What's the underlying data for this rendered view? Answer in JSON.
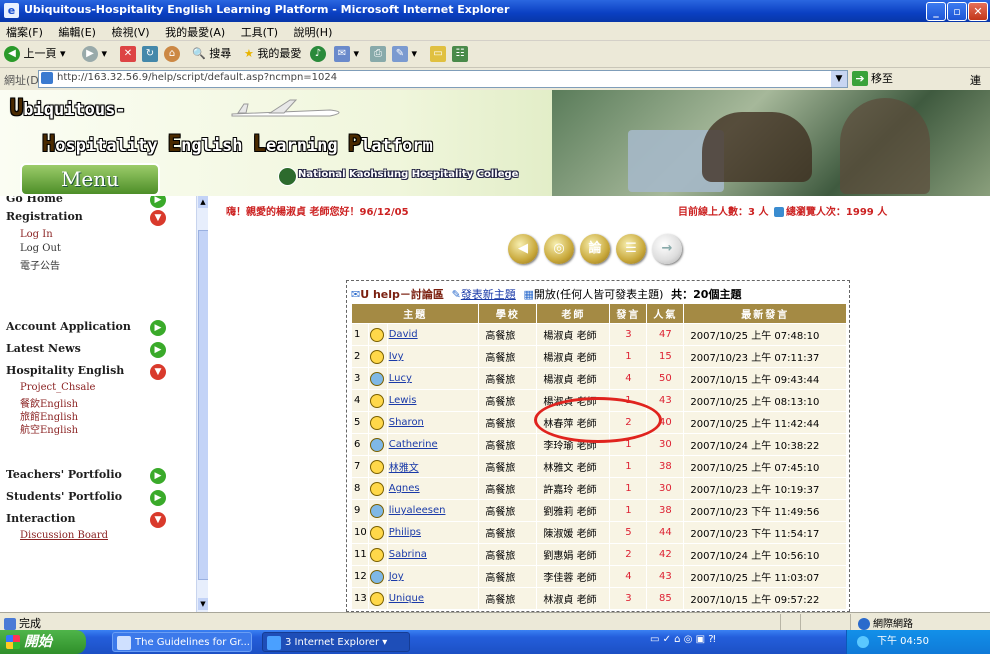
{
  "window": {
    "title": "Ubiquitous-Hospitality English Learning Platform - Microsoft Internet Explorer",
    "min": "_",
    "max": "▫",
    "close": "✕"
  },
  "menubar": [
    "檔案(F)",
    "編輯(E)",
    "檢視(V)",
    "我的最愛(A)",
    "工具(T)",
    "說明(H)"
  ],
  "toolbar": {
    "back": "上一頁",
    "search": "搜尋",
    "favorites": "我的最愛"
  },
  "address": {
    "label": "網址(D)",
    "url": "http://163.32.56.9/help/script/default.asp?ncmpn=1024",
    "go": "移至",
    "links": "連"
  },
  "banner": {
    "line1_first": "U",
    "line1_rest": "biquitous-",
    "line2_h": "H",
    "line2_h_rest": "ospitality ",
    "line2_e": "E",
    "line2_e_rest": "nglish ",
    "line2_l": "L",
    "line2_l_rest": "earning ",
    "line2_p": "P",
    "line2_p_rest": "latform",
    "college": "National Kaohsiung Hospitality College",
    "menu_tab": "Menu"
  },
  "sidebar": {
    "go_home": "Go Home",
    "registration": "Registration",
    "login": "Log In",
    "logout": "Log Out",
    "epaper": "電子公告",
    "account_application": "Account Application",
    "latest_news": "Latest News",
    "hospitality_english": "Hospitality English",
    "sub_links": [
      "Project_Chsale",
      "餐飲English",
      "旅館English",
      "航空English"
    ],
    "teachers_portfolio": "Teachers' Portfolio",
    "students_portfolio": "Students' Portfolio",
    "interaction": "Interaction",
    "discussion_board": "Discussion Board"
  },
  "main": {
    "greeting": "嗨！親愛的楊淑貞 老師您好！96/12/05",
    "online_prefix": "目前線上人數：3 人",
    "online_visits": "總瀏覽人次：1999 人",
    "round_buttons": [
      "◀",
      "◎",
      "論",
      "☰",
      "→"
    ],
    "board": {
      "title": "U help－討論區",
      "post_link": "發表新主題",
      "scope": "開放(任何人皆可發表主題)",
      "total": "共：20個主題",
      "columns": [
        "主題",
        "學校",
        "老師",
        "發言",
        "人氣",
        "最新發言"
      ],
      "rows": [
        {
          "no": "1",
          "subject": "David",
          "school": "高餐旅",
          "teacher": "楊淑貞 老師",
          "posts": "3",
          "views": "47",
          "latest": "2007/10/25 上午 07:48:10"
        },
        {
          "no": "2",
          "subject": "Ivy",
          "school": "高餐旅",
          "teacher": "楊淑貞 老師",
          "posts": "1",
          "views": "15",
          "latest": "2007/10/23 上午 07:11:37"
        },
        {
          "no": "3",
          "subject": "Lucy",
          "school": "高餐旅",
          "teacher": "楊淑貞 老師",
          "posts": "4",
          "views": "50",
          "latest": "2007/10/15 上午 09:43:44"
        },
        {
          "no": "4",
          "subject": "Lewis",
          "school": "高餐旅",
          "teacher": "楊淑貞 老師",
          "posts": "1",
          "views": "43",
          "latest": "2007/10/25 上午 08:13:10"
        },
        {
          "no": "5",
          "subject": "Sharon",
          "school": "高餐旅",
          "teacher": "林春萍 老師",
          "posts": "2",
          "views": "40",
          "latest": "2007/10/25 上午 11:42:44"
        },
        {
          "no": "6",
          "subject": "Catherine",
          "school": "高餐旅",
          "teacher": "李玲瑜 老師",
          "posts": "1",
          "views": "30",
          "latest": "2007/10/24 上午 10:38:22"
        },
        {
          "no": "7",
          "subject": "林雅文",
          "school": "高餐旅",
          "teacher": "林雅文 老師",
          "posts": "1",
          "views": "38",
          "latest": "2007/10/25 上午 07:45:10"
        },
        {
          "no": "8",
          "subject": "Agnes",
          "school": "高餐旅",
          "teacher": "許嘉玲 老師",
          "posts": "1",
          "views": "30",
          "latest": "2007/10/23 上午 10:19:37"
        },
        {
          "no": "9",
          "subject": "liuyaleesen",
          "school": "高餐旅",
          "teacher": "劉雅莉 老師",
          "posts": "1",
          "views": "38",
          "latest": "2007/10/23 下午 11:49:56"
        },
        {
          "no": "10",
          "subject": "Philips",
          "school": "高餐旅",
          "teacher": "陳淑媛 老師",
          "posts": "5",
          "views": "44",
          "latest": "2007/10/23 下午 11:54:17"
        },
        {
          "no": "11",
          "subject": "Sabrina",
          "school": "高餐旅",
          "teacher": "劉惠娟 老師",
          "posts": "2",
          "views": "42",
          "latest": "2007/10/24 上午 10:56:10"
        },
        {
          "no": "12",
          "subject": "Joy",
          "school": "高餐旅",
          "teacher": "李佳蓉 老師",
          "posts": "4",
          "views": "43",
          "latest": "2007/10/25 上午 11:03:07"
        },
        {
          "no": "13",
          "subject": "Unique",
          "school": "高餐旅",
          "teacher": "林淑貞 老師",
          "posts": "3",
          "views": "85",
          "latest": "2007/10/15 上午 09:57:22"
        }
      ]
    }
  },
  "statusbar": {
    "status": "完成",
    "zone": "網際網路"
  },
  "taskbar": {
    "start": "開始",
    "tasks": [
      "The Guidelines for Gr...",
      "3 Internet Explorer"
    ],
    "clock": "下午 04:50"
  },
  "colors": {
    "title_blue": "#0a3fc2",
    "board_header": "#a48a44",
    "highlight_red": "#e0231e",
    "menu_green": "#4d8e28"
  }
}
